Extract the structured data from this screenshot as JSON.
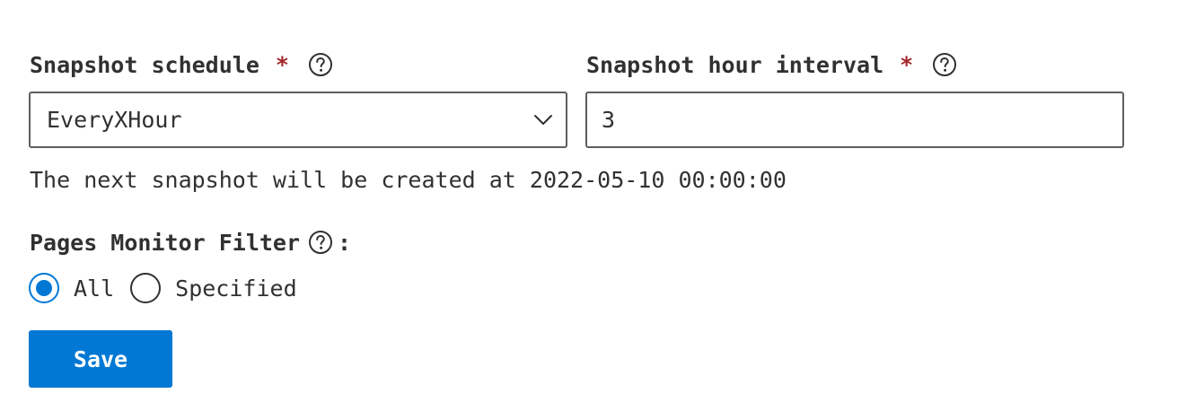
{
  "form": {
    "schedule": {
      "label": "Snapshot schedule",
      "required_marker": "*",
      "selected_value": "EveryXHour"
    },
    "interval": {
      "label": "Snapshot hour interval",
      "required_marker": "*",
      "value": "3"
    },
    "next_snapshot_text": "The next snapshot will be created at 2022-05-10 00:00:00",
    "pages_filter": {
      "label": "Pages Monitor Filter",
      "label_suffix": ":",
      "options": [
        {
          "label": "All",
          "checked": true
        },
        {
          "label": "Specified",
          "checked": false
        }
      ]
    },
    "save_label": "Save"
  },
  "colors": {
    "accent": "#0078d4",
    "required": "#a4262c",
    "text": "#323130",
    "border": "#605e5c"
  },
  "icons": {
    "help": "question-circle-icon",
    "dropdown": "chevron-down-icon"
  }
}
